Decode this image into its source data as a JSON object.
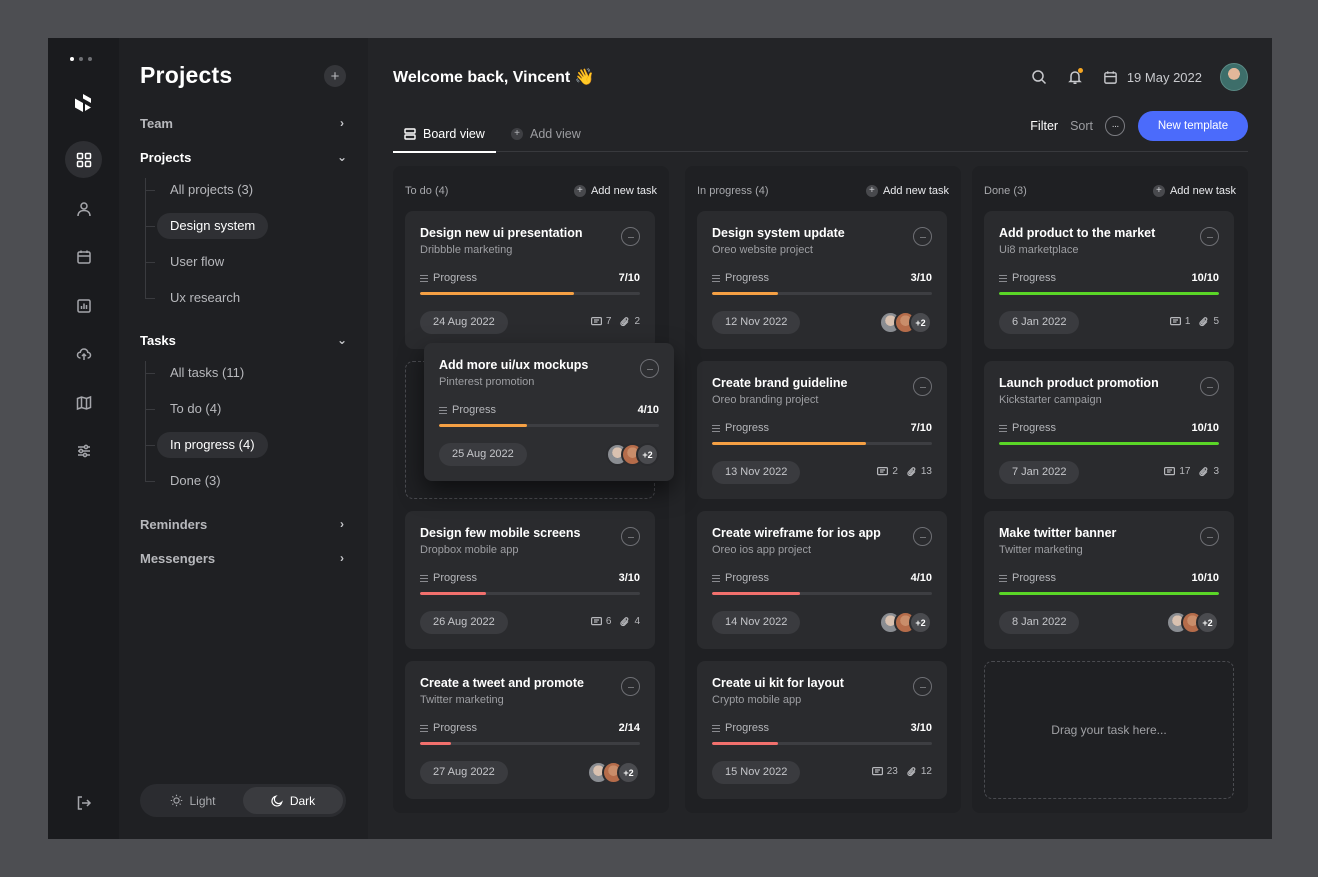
{
  "window": {
    "dots": 3
  },
  "sidebar": {
    "title": "Projects",
    "add_label": "+",
    "groups": {
      "team": "Team",
      "projects": "Projects",
      "tasks": "Tasks",
      "reminders": "Reminders",
      "messengers": "Messengers"
    },
    "project_items": [
      "All projects (3)",
      "Design system",
      "User flow",
      "Ux research"
    ],
    "task_items": [
      "All tasks (11)",
      "To do (4)",
      "In progress (4)",
      "Done (3)"
    ],
    "theme": {
      "light": "Light",
      "dark": "Dark",
      "selected": "Dark"
    }
  },
  "header": {
    "welcome": "Welcome back, Vincent 👋",
    "date": "19 May 2022"
  },
  "tabs": {
    "board": "Board view",
    "add": "Add view"
  },
  "toolbar": {
    "filter": "Filter",
    "sort": "Sort",
    "more": "···",
    "new_template": "New template"
  },
  "colors": {
    "accent": "#4b6bfb",
    "orange": "#f5a044",
    "red": "#f2706d",
    "green": "#5ad627"
  },
  "board": {
    "add_task_label": "Add new task",
    "columns": [
      {
        "title": "To do (4)",
        "cards": [
          {
            "title": "Design new ui presentation",
            "sub": "Dribbble marketing",
            "progress_label": "Progress",
            "progress": "7/10",
            "color": "orange",
            "date": "24 Aug 2022",
            "comments": "7",
            "attachments": "2"
          },
          {
            "title": "Add more ui/ux mockups",
            "sub": "Pinterest promotion",
            "progress_label": "Progress",
            "progress": "4/10",
            "color": "orange",
            "date": "25 Aug 2022",
            "extra": "+2"
          },
          {
            "title": "Design few mobile screens",
            "sub": "Dropbox mobile app",
            "progress_label": "Progress",
            "progress": "3/10",
            "color": "red",
            "date": "26 Aug 2022",
            "comments": "6",
            "attachments": "4"
          },
          {
            "title": "Create a tweet and promote",
            "sub": "Twitter marketing",
            "progress_label": "Progress",
            "progress": "2/14",
            "color": "red",
            "date": "27 Aug 2022",
            "extra": "+2"
          }
        ]
      },
      {
        "title": "In progress (4)",
        "cards": [
          {
            "title": "Design system update",
            "sub": "Oreo website project",
            "progress_label": "Progress",
            "progress": "3/10",
            "color": "orange",
            "date": "12 Nov 2022",
            "extra": "+2"
          },
          {
            "title": "Create brand guideline",
            "sub": "Oreo branding project",
            "progress_label": "Progress",
            "progress": "7/10",
            "color": "orange",
            "date": "13 Nov 2022",
            "comments": "2",
            "attachments": "13"
          },
          {
            "title": "Create wireframe for ios app",
            "sub": "Oreo ios app project",
            "progress_label": "Progress",
            "progress": "4/10",
            "color": "red",
            "date": "14 Nov 2022",
            "extra": "+2"
          },
          {
            "title": "Create ui kit for layout",
            "sub": "Crypto mobile app",
            "progress_label": "Progress",
            "progress": "3/10",
            "color": "red",
            "date": "15 Nov 2022",
            "comments": "23",
            "attachments": "12"
          }
        ]
      },
      {
        "title": "Done (3)",
        "cards": [
          {
            "title": "Add product to the market",
            "sub": "Ui8 marketplace",
            "progress_label": "Progress",
            "progress": "10/10",
            "color": "green",
            "date": "6 Jan 2022",
            "comments": "1",
            "attachments": "5"
          },
          {
            "title": "Launch product promotion",
            "sub": "Kickstarter campaign",
            "progress_label": "Progress",
            "progress": "10/10",
            "color": "green",
            "date": "7 Jan 2022",
            "comments": "17",
            "attachments": "3"
          },
          {
            "title": "Make twitter banner",
            "sub": "Twitter marketing",
            "progress_label": "Progress",
            "progress": "10/10",
            "color": "green",
            "date": "8 Jan 2022",
            "extra": "+2"
          }
        ],
        "dropzone": "Drag your task here..."
      }
    ]
  }
}
